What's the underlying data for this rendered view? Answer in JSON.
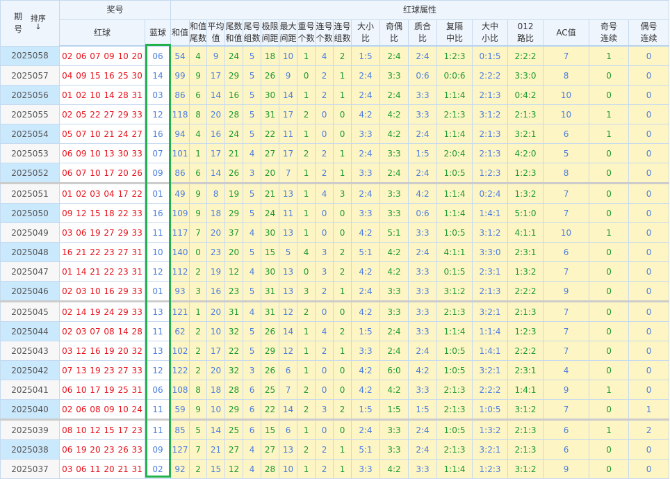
{
  "header": {
    "period": "期号",
    "period_l1": "期",
    "period_l2": "号",
    "sort_label": "排序",
    "sort_icon": "↓",
    "prize_group": "奖号",
    "red_attr_group": "红球属性",
    "red": "红球",
    "blue": "蓝球",
    "cols": [
      "和值",
      "和值尾数",
      "平均值",
      "尾数和值",
      "尾号组数",
      "极限间距",
      "最大间距",
      "重号个数",
      "连号个数",
      "连号组数",
      "大小比",
      "奇偶比",
      "质合比",
      "复隔中比",
      "大中小比",
      "012路比",
      "AC值",
      "奇号连续",
      "偶号连续"
    ],
    "cols_l1": [
      "和值",
      "和值",
      "平均",
      "尾数",
      "尾号",
      "极限",
      "最大",
      "重号",
      "连号",
      "连号",
      "大小",
      "奇偶",
      "质合",
      "复隔",
      "大中",
      "012",
      "AC值",
      "奇号",
      "偶号"
    ],
    "cols_l2": [
      "",
      "尾数",
      "值",
      "和值",
      "组数",
      "间距",
      "间距",
      "个数",
      "个数",
      "组数",
      "比",
      "比",
      "比",
      "中比",
      "小比",
      "路比",
      "",
      "连续",
      "连续"
    ]
  },
  "colors": {
    "red": "#e8101a",
    "blue": "#4a7fe0",
    "green": "#1d9a30",
    "highlight": "#22b14c",
    "stat_bg": "#fdf5c4"
  },
  "rows": [
    {
      "period": "2025058",
      "red": "02 06 07 09 10 20",
      "blue": "06",
      "stats": [
        "54",
        "4",
        "9",
        "24",
        "5",
        "18",
        "10",
        "1",
        "4",
        "2",
        "1:5",
        "2:4",
        "2:4",
        "1:2:3",
        "0:1:5",
        "2:2:2",
        "7",
        "1",
        "0"
      ]
    },
    {
      "period": "2025057",
      "red": "04 09 15 16 25 30",
      "blue": "14",
      "stats": [
        "99",
        "9",
        "17",
        "29",
        "5",
        "26",
        "9",
        "0",
        "2",
        "1",
        "2:4",
        "3:3",
        "0:6",
        "0:0:6",
        "2:2:2",
        "3:3:0",
        "8",
        "0",
        "0"
      ]
    },
    {
      "period": "2025056",
      "red": "01 02 10 14 28 31",
      "blue": "03",
      "stats": [
        "86",
        "6",
        "14",
        "16",
        "5",
        "30",
        "14",
        "1",
        "2",
        "1",
        "2:4",
        "2:4",
        "3:3",
        "1:1:4",
        "2:1:3",
        "0:4:2",
        "10",
        "0",
        "0"
      ]
    },
    {
      "period": "2025055",
      "red": "02 05 22 27 29 33",
      "blue": "12",
      "stats": [
        "118",
        "8",
        "20",
        "28",
        "5",
        "31",
        "17",
        "2",
        "0",
        "0",
        "4:2",
        "4:2",
        "3:3",
        "2:1:3",
        "3:1:2",
        "2:1:3",
        "10",
        "1",
        "0"
      ]
    },
    {
      "period": "2025054",
      "red": "05 07 10 21 24 27",
      "blue": "16",
      "stats": [
        "94",
        "4",
        "16",
        "24",
        "5",
        "22",
        "11",
        "1",
        "0",
        "0",
        "3:3",
        "4:2",
        "2:4",
        "1:1:4",
        "2:1:3",
        "3:2:1",
        "6",
        "1",
        "0"
      ]
    },
    {
      "period": "2025053",
      "red": "06 09 10 13 30 33",
      "blue": "07",
      "stats": [
        "101",
        "1",
        "17",
        "21",
        "4",
        "27",
        "17",
        "2",
        "2",
        "1",
        "2:4",
        "3:3",
        "1:5",
        "2:0:4",
        "2:1:3",
        "4:2:0",
        "5",
        "0",
        "0"
      ]
    },
    {
      "period": "2025052",
      "red": "06 07 10 17 20 26",
      "blue": "09",
      "stats": [
        "86",
        "6",
        "14",
        "26",
        "3",
        "20",
        "7",
        "1",
        "2",
        "1",
        "3:3",
        "2:4",
        "2:4",
        "1:0:5",
        "1:2:3",
        "1:2:3",
        "8",
        "0",
        "0"
      ],
      "sep": true
    },
    {
      "period": "2025051",
      "red": "01 02 03 04 17 22",
      "blue": "01",
      "stats": [
        "49",
        "9",
        "8",
        "19",
        "5",
        "21",
        "13",
        "1",
        "4",
        "3",
        "2:4",
        "3:3",
        "4:2",
        "1:1:4",
        "0:2:4",
        "1:3:2",
        "7",
        "0",
        "0"
      ]
    },
    {
      "period": "2025050",
      "red": "09 12 15 18 22 33",
      "blue": "16",
      "stats": [
        "109",
        "9",
        "18",
        "29",
        "5",
        "24",
        "11",
        "1",
        "0",
        "0",
        "3:3",
        "3:3",
        "0:6",
        "1:1:4",
        "1:4:1",
        "5:1:0",
        "7",
        "0",
        "0"
      ]
    },
    {
      "period": "2025049",
      "red": "03 06 19 27 29 33",
      "blue": "11",
      "stats": [
        "117",
        "7",
        "20",
        "37",
        "4",
        "30",
        "13",
        "1",
        "0",
        "0",
        "4:2",
        "5:1",
        "3:3",
        "1:0:5",
        "3:1:2",
        "4:1:1",
        "10",
        "1",
        "0"
      ]
    },
    {
      "period": "2025048",
      "red": "16 21 22 23 27 31",
      "blue": "10",
      "stats": [
        "140",
        "0",
        "23",
        "20",
        "5",
        "15",
        "5",
        "4",
        "3",
        "2",
        "5:1",
        "4:2",
        "2:4",
        "4:1:1",
        "3:3:0",
        "2:3:1",
        "6",
        "0",
        "0"
      ]
    },
    {
      "period": "2025047",
      "red": "01 14 21 22 23 31",
      "blue": "12",
      "stats": [
        "112",
        "2",
        "19",
        "12",
        "4",
        "30",
        "13",
        "0",
        "3",
        "2",
        "4:2",
        "4:2",
        "3:3",
        "0:1:5",
        "2:3:1",
        "1:3:2",
        "7",
        "0",
        "0"
      ]
    },
    {
      "period": "2025046",
      "red": "02 03 10 16 29 33",
      "blue": "01",
      "stats": [
        "93",
        "3",
        "16",
        "23",
        "5",
        "31",
        "13",
        "3",
        "2",
        "1",
        "2:4",
        "3:3",
        "3:3",
        "3:1:2",
        "2:1:3",
        "2:2:2",
        "9",
        "0",
        "0"
      ],
      "sep": true
    },
    {
      "period": "2025045",
      "red": "02 14 19 24 29 33",
      "blue": "13",
      "stats": [
        "121",
        "1",
        "20",
        "31",
        "4",
        "31",
        "12",
        "2",
        "0",
        "0",
        "4:2",
        "3:3",
        "3:3",
        "2:1:3",
        "3:2:1",
        "2:1:3",
        "7",
        "0",
        "0"
      ]
    },
    {
      "period": "2025044",
      "red": "02 03 07 08 14 28",
      "blue": "11",
      "stats": [
        "62",
        "2",
        "10",
        "32",
        "5",
        "26",
        "14",
        "1",
        "4",
        "2",
        "1:5",
        "2:4",
        "3:3",
        "1:1:4",
        "1:1:4",
        "1:2:3",
        "7",
        "0",
        "0"
      ]
    },
    {
      "period": "2025043",
      "red": "03 12 16 19 20 32",
      "blue": "13",
      "stats": [
        "102",
        "2",
        "17",
        "22",
        "5",
        "29",
        "12",
        "1",
        "2",
        "1",
        "3:3",
        "2:4",
        "2:4",
        "1:0:5",
        "1:4:1",
        "2:2:2",
        "7",
        "0",
        "0"
      ]
    },
    {
      "period": "2025042",
      "red": "07 13 19 23 27 33",
      "blue": "12",
      "stats": [
        "122",
        "2",
        "20",
        "32",
        "3",
        "26",
        "6",
        "1",
        "0",
        "0",
        "4:2",
        "6:0",
        "4:2",
        "1:0:5",
        "3:2:1",
        "2:3:1",
        "4",
        "0",
        "0"
      ]
    },
    {
      "period": "2025041",
      "red": "06 10 17 19 25 31",
      "blue": "06",
      "stats": [
        "108",
        "8",
        "18",
        "28",
        "6",
        "25",
        "7",
        "2",
        "0",
        "0",
        "4:2",
        "4:2",
        "3:3",
        "2:1:3",
        "2:2:2",
        "1:4:1",
        "9",
        "1",
        "0"
      ]
    },
    {
      "period": "2025040",
      "red": "02 06 08 09 10 24",
      "blue": "11",
      "stats": [
        "59",
        "9",
        "10",
        "29",
        "6",
        "22",
        "14",
        "2",
        "3",
        "2",
        "1:5",
        "1:5",
        "1:5",
        "2:1:3",
        "1:0:5",
        "3:1:2",
        "7",
        "0",
        "1"
      ],
      "sep": true
    },
    {
      "period": "2025039",
      "red": "08 10 12 15 17 23",
      "blue": "11",
      "stats": [
        "85",
        "5",
        "14",
        "25",
        "6",
        "15",
        "6",
        "1",
        "0",
        "0",
        "2:4",
        "3:3",
        "2:4",
        "1:0:5",
        "1:3:2",
        "2:1:3",
        "6",
        "1",
        "2"
      ]
    },
    {
      "period": "2025038",
      "red": "06 19 20 23 26 33",
      "blue": "09",
      "stats": [
        "127",
        "7",
        "21",
        "27",
        "4",
        "27",
        "13",
        "2",
        "2",
        "1",
        "5:1",
        "3:3",
        "2:4",
        "2:1:3",
        "3:2:1",
        "2:1:3",
        "6",
        "0",
        "0"
      ]
    },
    {
      "period": "2025037",
      "red": "03 06 11 20 21 31",
      "blue": "02",
      "stats": [
        "92",
        "2",
        "15",
        "12",
        "4",
        "28",
        "10",
        "1",
        "2",
        "1",
        "3:3",
        "4:2",
        "3:3",
        "1:1:4",
        "1:2:3",
        "3:1:2",
        "9",
        "0",
        "0"
      ]
    }
  ]
}
